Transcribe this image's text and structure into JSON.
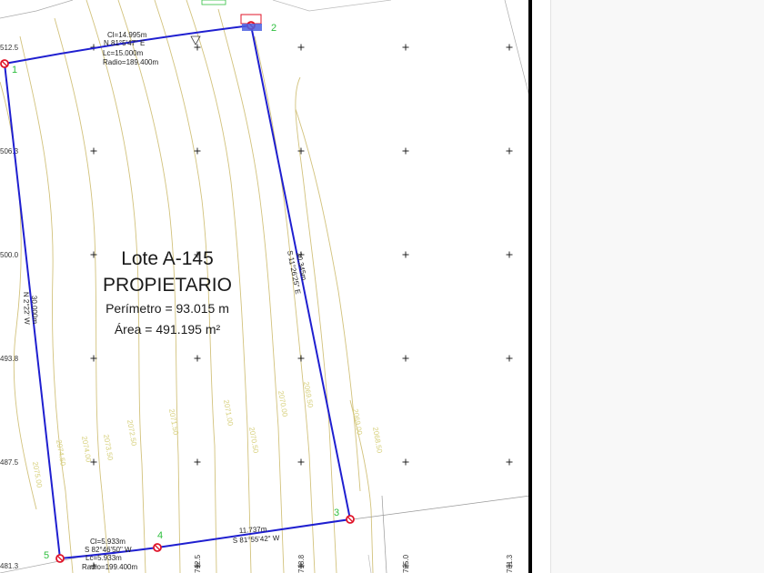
{
  "lot": {
    "name": "Lote A-145",
    "owner": "PROPIETARIO",
    "perimeter": "Perímetro = 93.015 m",
    "area": "Área = 491.195 m²"
  },
  "colors": {
    "boundary": "#1f1fd0",
    "contour": "#d2c27c",
    "vertex": "#e0152a",
    "vertex_label": "#2fbf3f",
    "grid_cross": "#111111"
  },
  "vertices": [
    {
      "label": "1"
    },
    {
      "label": "2"
    },
    {
      "label": "3"
    },
    {
      "label": "4"
    },
    {
      "label": "5"
    }
  ],
  "dimensions": {
    "top_arc": [
      "Cl=14.995m",
      "N 81°5'47\" E",
      "Lc=15.000m",
      "Radio=189.400m"
    ],
    "east_side": [
      "30.345m",
      "S 11°26'25\" E"
    ],
    "west_side": [
      "30.000m",
      "N 2°22' W"
    ],
    "south_side": [
      "11.737m",
      "S 81°55'42\" W"
    ],
    "bottom_arc": [
      "Cl=5.933m",
      "S 82°46'50\" W",
      "Lc=5.933m",
      "Radio=199.400m"
    ]
  },
  "coord_labels": {
    "y": [
      "512.5",
      "506.3",
      "500.0",
      "493.8",
      "487.5",
      "481.3"
    ],
    "x": [
      "712.5",
      "718.8",
      "725.0",
      "731.3"
    ]
  },
  "contour_labels": [
    "2075.00",
    "2074.50",
    "2074.00",
    "2073.50",
    "2072.50",
    "2071.50",
    "2071.00",
    "2070.50",
    "2070.00",
    "2069.50",
    "2069.00",
    "2068.50"
  ]
}
